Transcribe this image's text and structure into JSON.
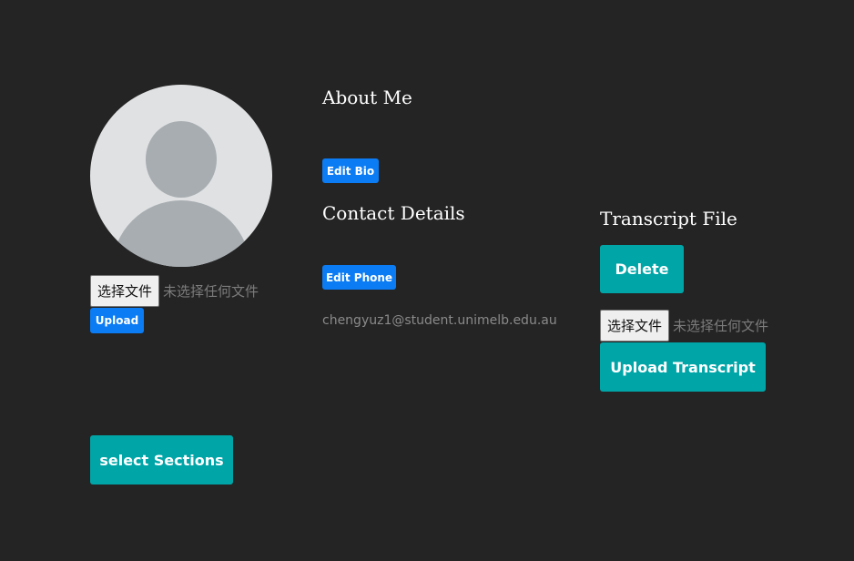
{
  "profile": {
    "avatar_alt": "user avatar placeholder",
    "file_button_label": "选择文件",
    "file_status": "未选择任何文件",
    "upload_label": "Upload"
  },
  "about": {
    "title": "About Me",
    "edit_bio_label": "Edit Bio"
  },
  "contact": {
    "title": "Contact Details",
    "edit_phone_label": "Edit Phone",
    "email": "chengyuz1@student.unimelb.edu.au"
  },
  "transcript": {
    "title": "Transcript File",
    "delete_label": "Delete",
    "file_button_label": "选择文件",
    "file_status": "未选择任何文件",
    "upload_label": "Upload Transcript"
  },
  "sections": {
    "select_label": "select Sections"
  },
  "colors": {
    "background": "#242424",
    "primary_blue": "#0b7cf3",
    "teal": "#00a5a8"
  }
}
